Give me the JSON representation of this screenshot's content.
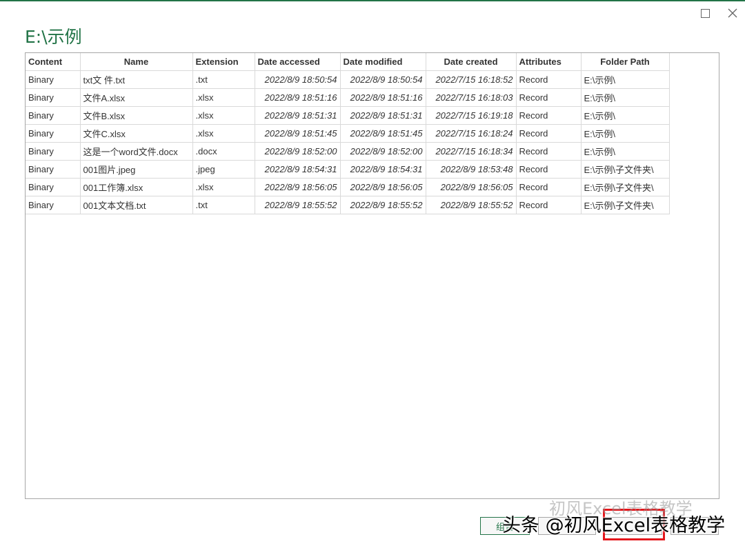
{
  "window": {
    "maximize_icon": "maximize-icon",
    "close_icon": "close-icon",
    "accent_color": "#217346"
  },
  "dialog": {
    "title": "E:\\示例"
  },
  "table": {
    "columns": [
      "Content",
      "Name",
      "Extension",
      "Date accessed",
      "Date modified",
      "Date created",
      "Attributes",
      "Folder Path"
    ],
    "rows": [
      [
        "Binary",
        "txt文 件.txt",
        ".txt",
        "2022/8/9 18:50:54",
        "2022/8/9 18:50:54",
        "2022/7/15 16:18:52",
        "Record",
        "E:\\示例\\"
      ],
      [
        "Binary",
        "文件A.xlsx",
        ".xlsx",
        "2022/8/9 18:51:16",
        "2022/8/9 18:51:16",
        "2022/7/15 16:18:03",
        "Record",
        "E:\\示例\\"
      ],
      [
        "Binary",
        "文件B.xlsx",
        ".xlsx",
        "2022/8/9 18:51:31",
        "2022/8/9 18:51:31",
        "2022/7/15 16:19:18",
        "Record",
        "E:\\示例\\"
      ],
      [
        "Binary",
        "文件C.xlsx",
        ".xlsx",
        "2022/8/9 18:51:45",
        "2022/8/9 18:51:45",
        "2022/7/15 16:18:24",
        "Record",
        "E:\\示例\\"
      ],
      [
        "Binary",
        "这是一个word文件.docx",
        ".docx",
        "2022/8/9 18:52:00",
        "2022/8/9 18:52:00",
        "2022/7/15 16:18:34",
        "Record",
        "E:\\示例\\"
      ],
      [
        "Binary",
        "001图片.jpeg",
        ".jpeg",
        "2022/8/9 18:54:31",
        "2022/8/9 18:54:31",
        "2022/8/9 18:53:48",
        "Record",
        "E:\\示例\\子文件夹\\"
      ],
      [
        "Binary",
        "001工作簿.xlsx",
        ".xlsx",
        "2022/8/9 18:56:05",
        "2022/8/9 18:56:05",
        "2022/8/9 18:56:05",
        "Record",
        "E:\\示例\\子文件夹\\"
      ],
      [
        "Binary",
        "001文本文档.txt",
        ".txt",
        "2022/8/9 18:55:52",
        "2022/8/9 18:55:52",
        "2022/8/9 18:55:52",
        "Record",
        "E:\\示例\\子文件夹\\"
      ]
    ]
  },
  "footer": {
    "combine_label": "组合",
    "load_label": "",
    "transform_label": "",
    "cancel_label": ""
  },
  "watermark": {
    "faint_text": "初风Excel表格教学",
    "text": "头条 @初风Excel表格教学"
  },
  "highlight_color": "#e4161b"
}
